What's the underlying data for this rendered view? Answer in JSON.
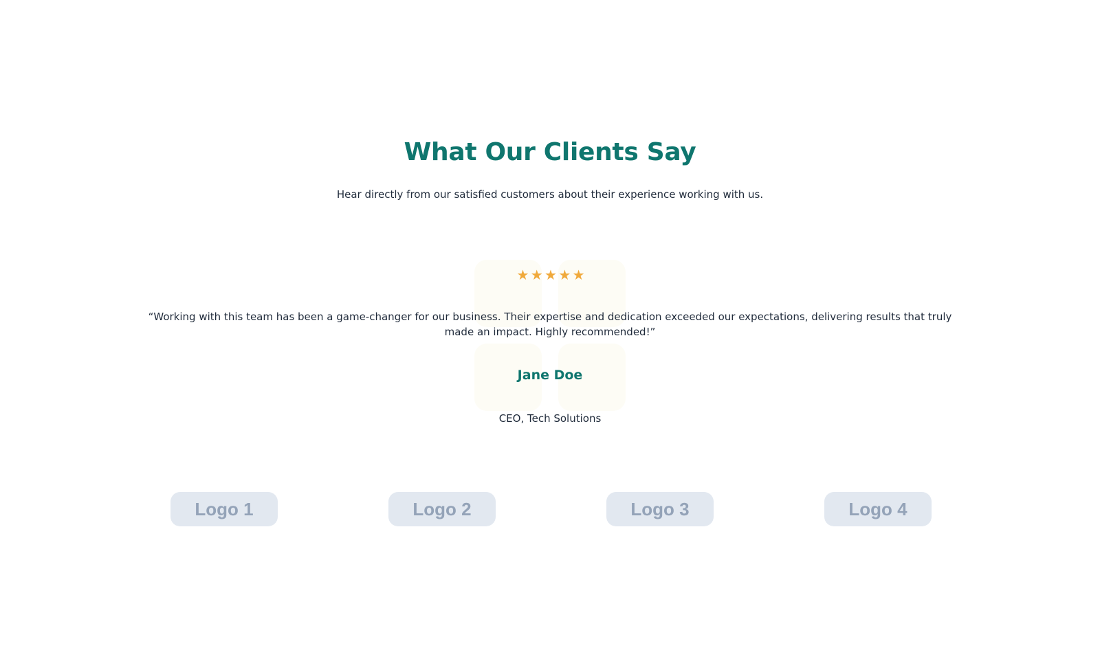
{
  "section": {
    "title": "What Our Clients Say",
    "subtitle": "Hear directly from our satisfied customers about their experience working with us."
  },
  "testimonial": {
    "rating": 5,
    "rating_max": 5,
    "star_icon": "star-icon",
    "star_glyph": "★",
    "quote": "“Working with this team has been a game-changer for our business. Their expertise and dedication exceeded our expectations, delivering results that truly made an impact. Highly recommended!”",
    "author_name": "Jane Doe",
    "author_role": "CEO, Tech Solutions"
  },
  "logos": [
    {
      "label": "Logo 1"
    },
    {
      "label": "Logo 2"
    },
    {
      "label": "Logo 3"
    },
    {
      "label": "Logo 4"
    }
  ],
  "colors": {
    "accent": "#0f766e",
    "text": "#1f2a3a",
    "star": "#f0a93b",
    "logo_bg": "#e2e8f0",
    "logo_text": "#94a3b8",
    "decor_bg": "#fdfcf5"
  }
}
